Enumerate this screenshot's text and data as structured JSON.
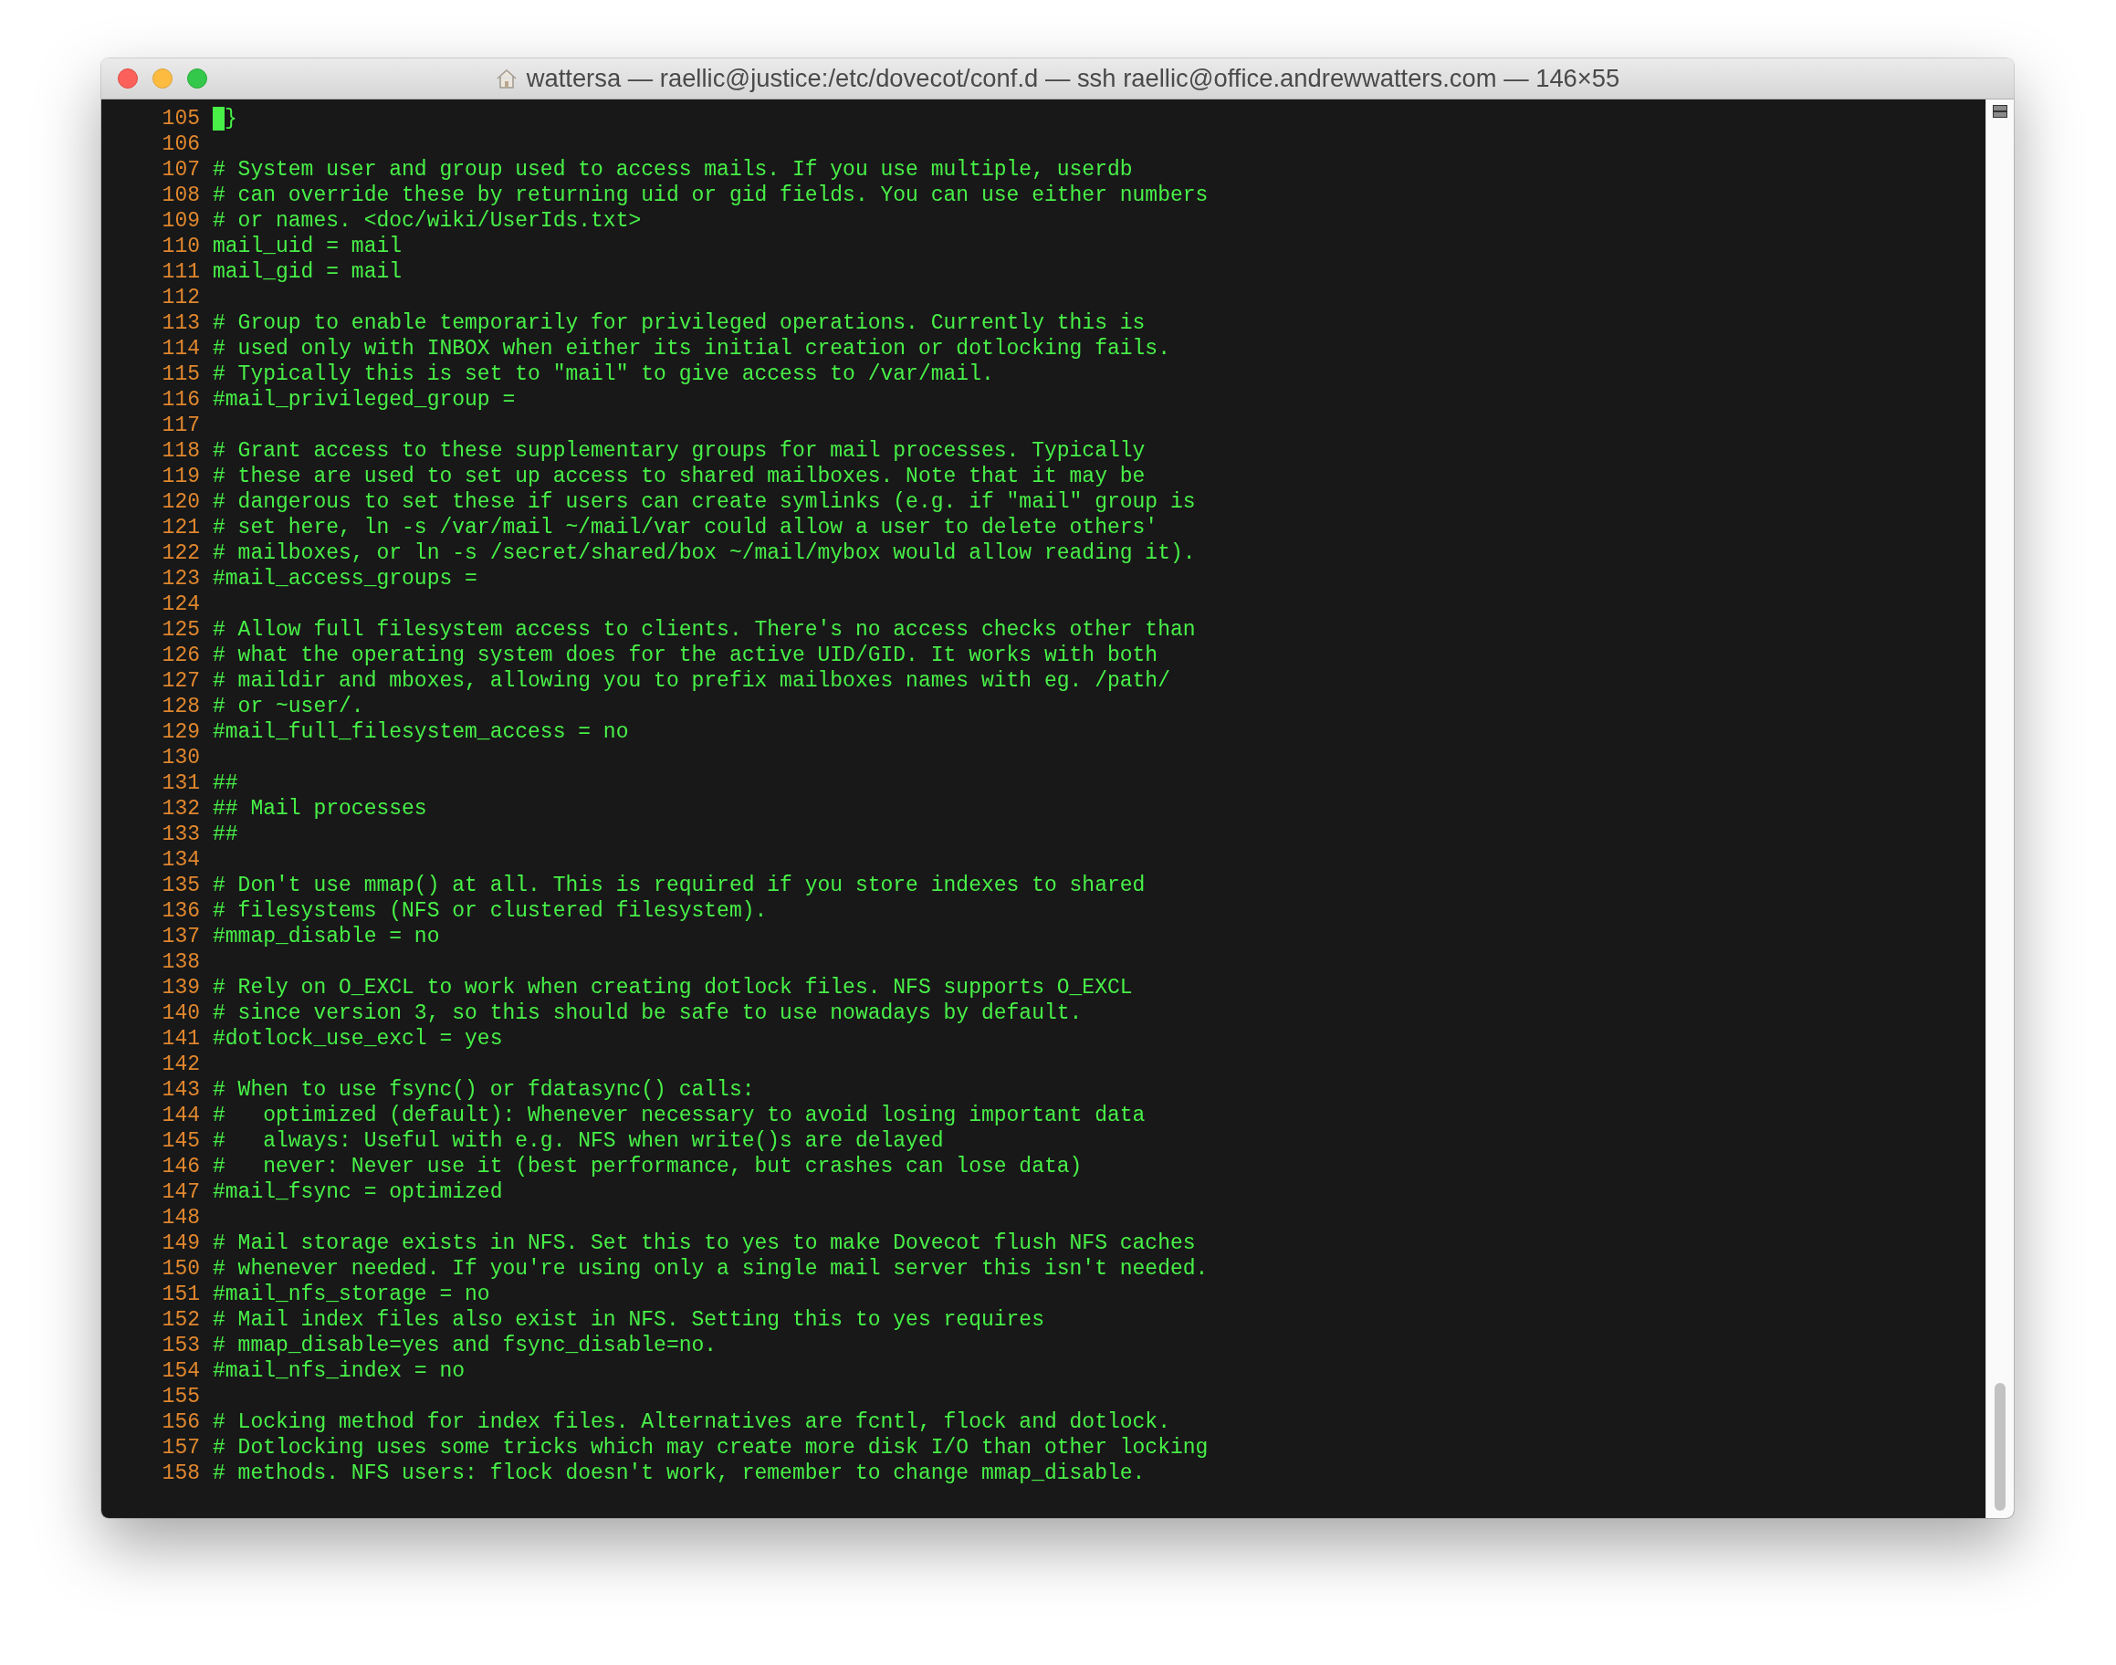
{
  "window": {
    "title": "wattersa — raellic@justice:/etc/dovecot/conf.d — ssh raellic@office.andrewwatters.com — 146×55"
  },
  "lines": [
    {
      "number": "105",
      "text": "}",
      "cursor": true
    },
    {
      "number": "106"
    },
    {
      "number": "107",
      "text": "# System user and group used to access mails. If you use multiple, userdb"
    },
    {
      "number": "108",
      "text": "# can override these by returning uid or gid fields. You can use either numbers"
    },
    {
      "number": "109",
      "text": "# or names. <doc/wiki/UserIds.txt>"
    },
    {
      "number": "110",
      "text": "mail_uid = mail"
    },
    {
      "number": "111",
      "text": "mail_gid = mail"
    },
    {
      "number": "112"
    },
    {
      "number": "113",
      "text": "# Group to enable temporarily for privileged operations. Currently this is"
    },
    {
      "number": "114",
      "text": "# used only with INBOX when either its initial creation or dotlocking fails."
    },
    {
      "number": "115",
      "text": "# Typically this is set to \"mail\" to give access to /var/mail."
    },
    {
      "number": "116",
      "text": "#mail_privileged_group ="
    },
    {
      "number": "117"
    },
    {
      "number": "118",
      "text": "# Grant access to these supplementary groups for mail processes. Typically"
    },
    {
      "number": "119",
      "text": "# these are used to set up access to shared mailboxes. Note that it may be"
    },
    {
      "number": "120",
      "text": "# dangerous to set these if users can create symlinks (e.g. if \"mail\" group is"
    },
    {
      "number": "121",
      "text": "# set here, ln -s /var/mail ~/mail/var could allow a user to delete others'"
    },
    {
      "number": "122",
      "text": "# mailboxes, or ln -s /secret/shared/box ~/mail/mybox would allow reading it)."
    },
    {
      "number": "123",
      "text": "#mail_access_groups ="
    },
    {
      "number": "124"
    },
    {
      "number": "125",
      "text": "# Allow full filesystem access to clients. There's no access checks other than"
    },
    {
      "number": "126",
      "text": "# what the operating system does for the active UID/GID. It works with both"
    },
    {
      "number": "127",
      "text": "# maildir and mboxes, allowing you to prefix mailboxes names with eg. /path/"
    },
    {
      "number": "128",
      "text": "# or ~user/."
    },
    {
      "number": "129",
      "text": "#mail_full_filesystem_access = no"
    },
    {
      "number": "130"
    },
    {
      "number": "131",
      "text": "##"
    },
    {
      "number": "132",
      "text": "## Mail processes"
    },
    {
      "number": "133",
      "text": "##"
    },
    {
      "number": "134"
    },
    {
      "number": "135",
      "text": "# Don't use mmap() at all. This is required if you store indexes to shared"
    },
    {
      "number": "136",
      "text": "# filesystems (NFS or clustered filesystem)."
    },
    {
      "number": "137",
      "text": "#mmap_disable = no"
    },
    {
      "number": "138"
    },
    {
      "number": "139",
      "text": "# Rely on O_EXCL to work when creating dotlock files. NFS supports O_EXCL"
    },
    {
      "number": "140",
      "text": "# since version 3, so this should be safe to use nowadays by default."
    },
    {
      "number": "141",
      "text": "#dotlock_use_excl = yes"
    },
    {
      "number": "142"
    },
    {
      "number": "143",
      "text": "# When to use fsync() or fdatasync() calls:"
    },
    {
      "number": "144",
      "text": "#   optimized (default): Whenever necessary to avoid losing important data"
    },
    {
      "number": "145",
      "text": "#   always: Useful with e.g. NFS when write()s are delayed"
    },
    {
      "number": "146",
      "text": "#   never: Never use it (best performance, but crashes can lose data)"
    },
    {
      "number": "147",
      "text": "#mail_fsync = optimized"
    },
    {
      "number": "148"
    },
    {
      "number": "149",
      "text": "# Mail storage exists in NFS. Set this to yes to make Dovecot flush NFS caches"
    },
    {
      "number": "150",
      "text": "# whenever needed. If you're using only a single mail server this isn't needed."
    },
    {
      "number": "151",
      "text": "#mail_nfs_storage = no"
    },
    {
      "number": "152",
      "text": "# Mail index files also exist in NFS. Setting this to yes requires"
    },
    {
      "number": "153",
      "text": "# mmap_disable=yes and fsync_disable=no."
    },
    {
      "number": "154",
      "text": "#mail_nfs_index = no"
    },
    {
      "number": "155"
    },
    {
      "number": "156",
      "text": "# Locking method for index files. Alternatives are fcntl, flock and dotlock."
    },
    {
      "number": "157",
      "text": "# Dotlocking uses some tricks which may create more disk I/O than other locking"
    },
    {
      "number": "158",
      "text": "# methods. NFS users: flock doesn't work, remember to change mmap_disable."
    }
  ]
}
